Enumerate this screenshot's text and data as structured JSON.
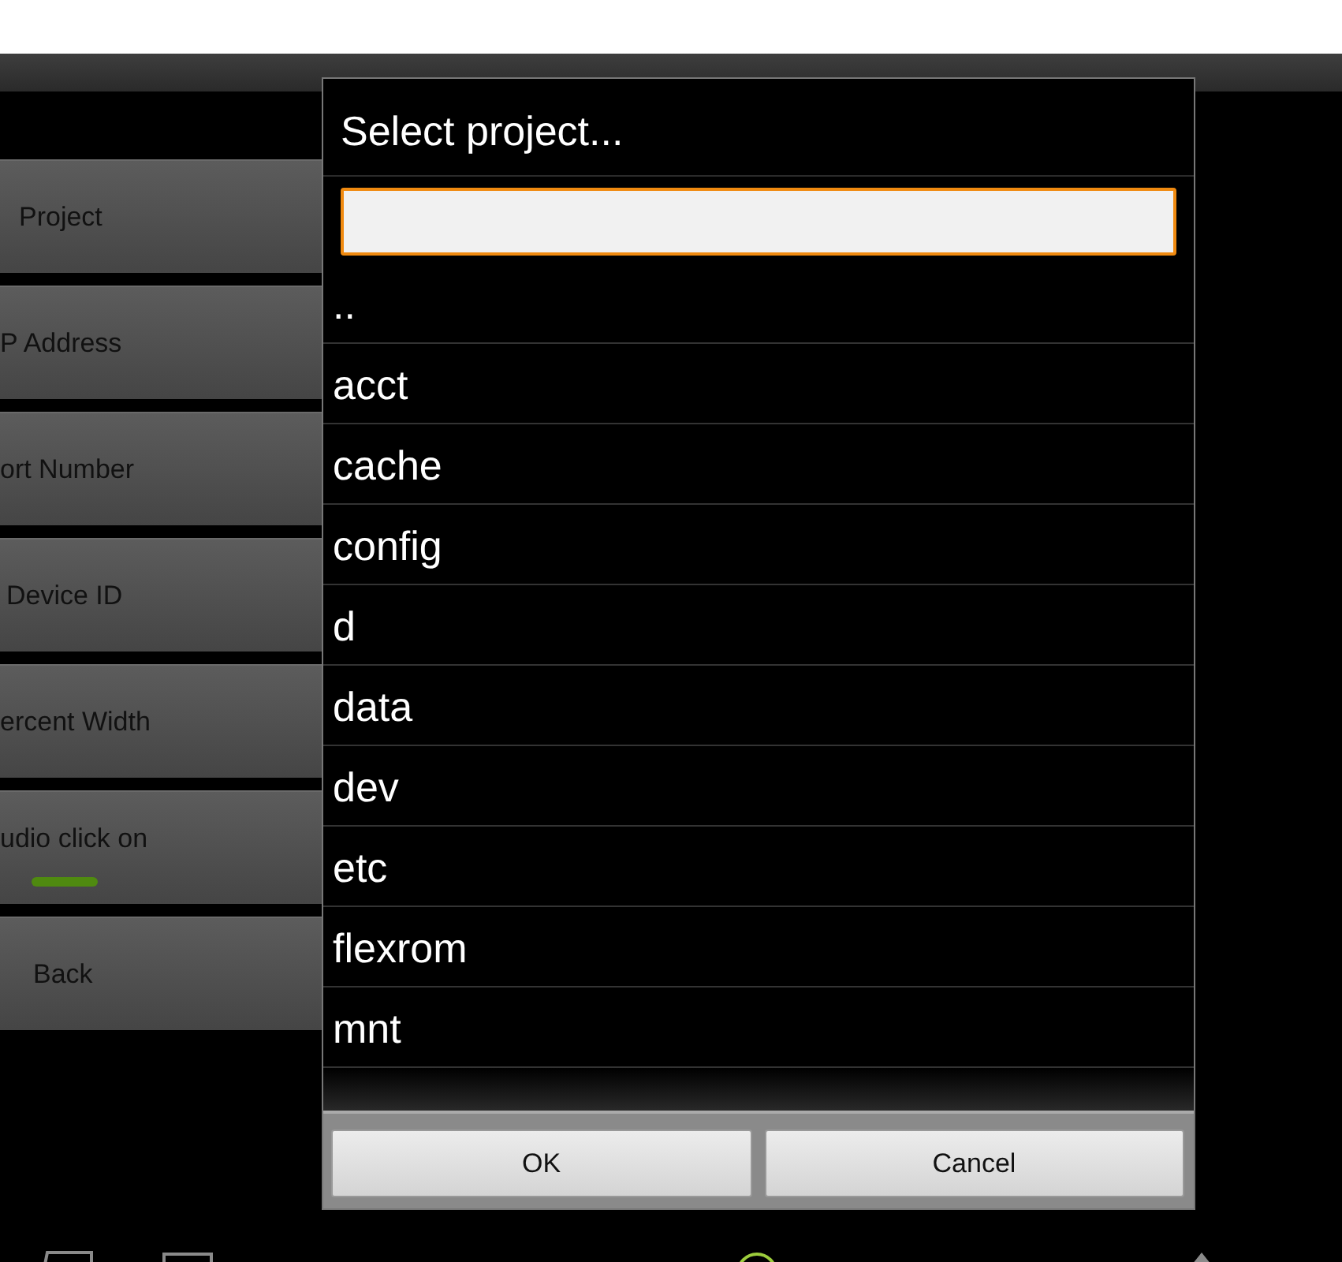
{
  "settings_buttons": [
    {
      "label": "Project",
      "kind": "button"
    },
    {
      "label": "P Address",
      "kind": "button"
    },
    {
      "label": "ort Number",
      "kind": "button"
    },
    {
      "label": "Device ID",
      "kind": "button"
    },
    {
      "label": "ercent Width",
      "kind": "button"
    },
    {
      "label": "udio click on",
      "kind": "toggle",
      "on": true
    },
    {
      "label": "Back",
      "kind": "button"
    }
  ],
  "dialog": {
    "title": "Select project...",
    "items": [
      "..",
      "acct",
      "cache",
      "config",
      "d",
      "data",
      "dev",
      "etc",
      "flexrom",
      "mnt"
    ],
    "buttons": [
      "OK",
      "Cancel"
    ]
  }
}
